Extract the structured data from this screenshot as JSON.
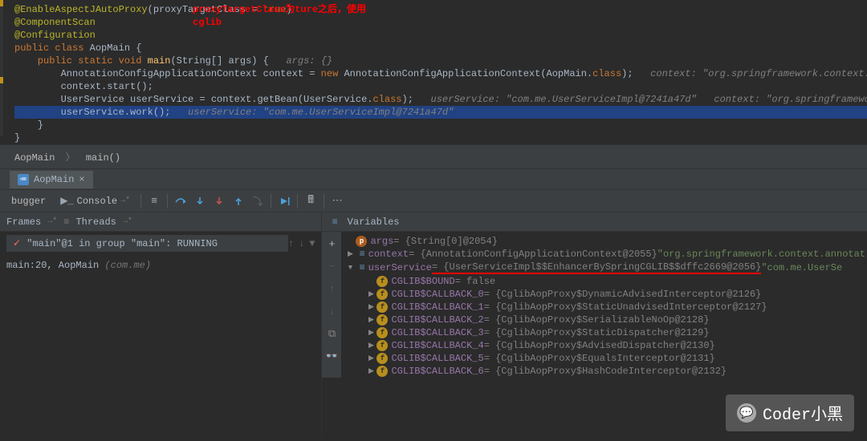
{
  "annotation": {
    "line1": "proxyTargetClass为ture之后，使用",
    "line2": "cglib"
  },
  "code": {
    "l1a": "@EnableAspectJAutoProxy",
    "l1b": "(proxyTargetClass = ",
    "l1c": "true",
    "l1d": ")",
    "l2": "@ComponentScan",
    "l3": "@Configuration",
    "l4a": "public class ",
    "l4b": "AopMain",
    "l4c": " {",
    "l5a": "    public static void ",
    "l5b": "main",
    "l5c": "(String[] args) {   ",
    "l5d": "args: {}",
    "l6a": "        AnnotationConfigApplicationContext context = ",
    "l6b": "new ",
    "l6c": "AnnotationConfigApplicationContext(AopMain.",
    "l6d": "class",
    "l6e": ");   ",
    "l6f": "context: \"org.springframework.context.annota",
    "l7a": "        context.start();",
    "l8a": "        UserService userService = context.getBean(UserService.",
    "l8b": "class",
    "l8c": ");   ",
    "l8d": "userService: \"com.me.UserServiceImpl@7241a47d\"   context: \"org.springframework.cont",
    "l9a": "        userService.work();   ",
    "l9b": "userService: \"com.me.UserServiceImpl@7241a47d\"",
    "l10": "    }",
    "l11": "}"
  },
  "breadcrumb": {
    "c1": "AopMain",
    "c2": "main()"
  },
  "tab": {
    "name": "AopMain"
  },
  "debugger": {
    "tabs": {
      "t1": "bugger",
      "t2": "Console"
    },
    "left": {
      "frames": "Frames",
      "threads": "Threads",
      "thread_label": "\"main\"@1 in group \"main\": RUNNING",
      "stack_frame": "main:20, AopMain ",
      "stack_frame_pkg": "(com.me)"
    },
    "vars": {
      "title": "Variables",
      "args_n": "args",
      "args_v": " = {String[0]@2054}",
      "ctx_n": "context",
      "ctx_v": " = {AnnotationConfigApplicationContext@2055} ",
      "ctx_s": "\"org.springframework.context.annotat",
      "us_n": "userService",
      "us_v": " = {UserServiceImpl$$EnhancerBySpringCGLIB$$dffc2669@2056} ",
      "us_s": "\"com.me.UserSe",
      "bound_n": "CGLIB$BOUND",
      "bound_v": " = false",
      "cb0_n": "CGLIB$CALLBACK_0",
      "cb0_v": " = {CglibAopProxy$DynamicAdvisedInterceptor@2126}",
      "cb1_n": "CGLIB$CALLBACK_1",
      "cb1_v": " = {CglibAopProxy$StaticUnadvisedInterceptor@2127}",
      "cb2_n": "CGLIB$CALLBACK_2",
      "cb2_v": " = {CglibAopProxy$SerializableNoOp@2128}",
      "cb3_n": "CGLIB$CALLBACK_3",
      "cb3_v": " = {CglibAopProxy$StaticDispatcher@2129}",
      "cb4_n": "CGLIB$CALLBACK_4",
      "cb4_v": " = {CglibAopProxy$AdvisedDispatcher@2130}",
      "cb5_n": "CGLIB$CALLBACK_5",
      "cb5_v": " = {CglibAopProxy$EqualsInterceptor@2131}",
      "cb6_n": "CGLIB$CALLBACK_6",
      "cb6_v": " = {CglibAopProxy$HashCodeInterceptor@2132}"
    }
  },
  "watermark": "Coder小黑"
}
